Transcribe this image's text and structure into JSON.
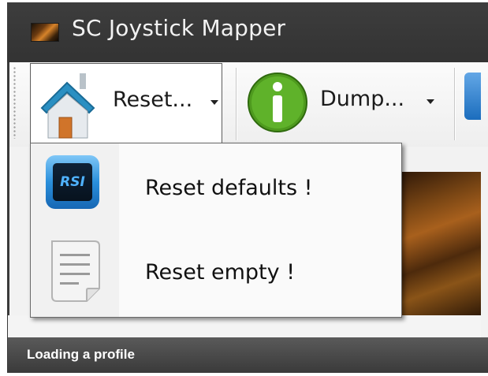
{
  "window": {
    "title": "SC Joystick Mapper",
    "app_icon": "app-logo-icon"
  },
  "toolbar": {
    "reset_label": "Reset...",
    "reset_icon": "home-icon",
    "dump_label": "Dump...",
    "dump_icon": "info-icon"
  },
  "reset_menu": {
    "items": [
      {
        "label": "Reset defaults !",
        "icon": "rsi-icon"
      },
      {
        "label": "Reset empty !",
        "icon": "document-icon"
      }
    ],
    "rsi_text": "RSI"
  },
  "status": {
    "caption": "Loading a profile"
  },
  "colors": {
    "titlebar": "#333333",
    "menu_border": "#6a6a6a",
    "status_bar": "#4a4a4a",
    "info_green": "#4e9a1e",
    "home_blue": "#2a8fc2"
  }
}
